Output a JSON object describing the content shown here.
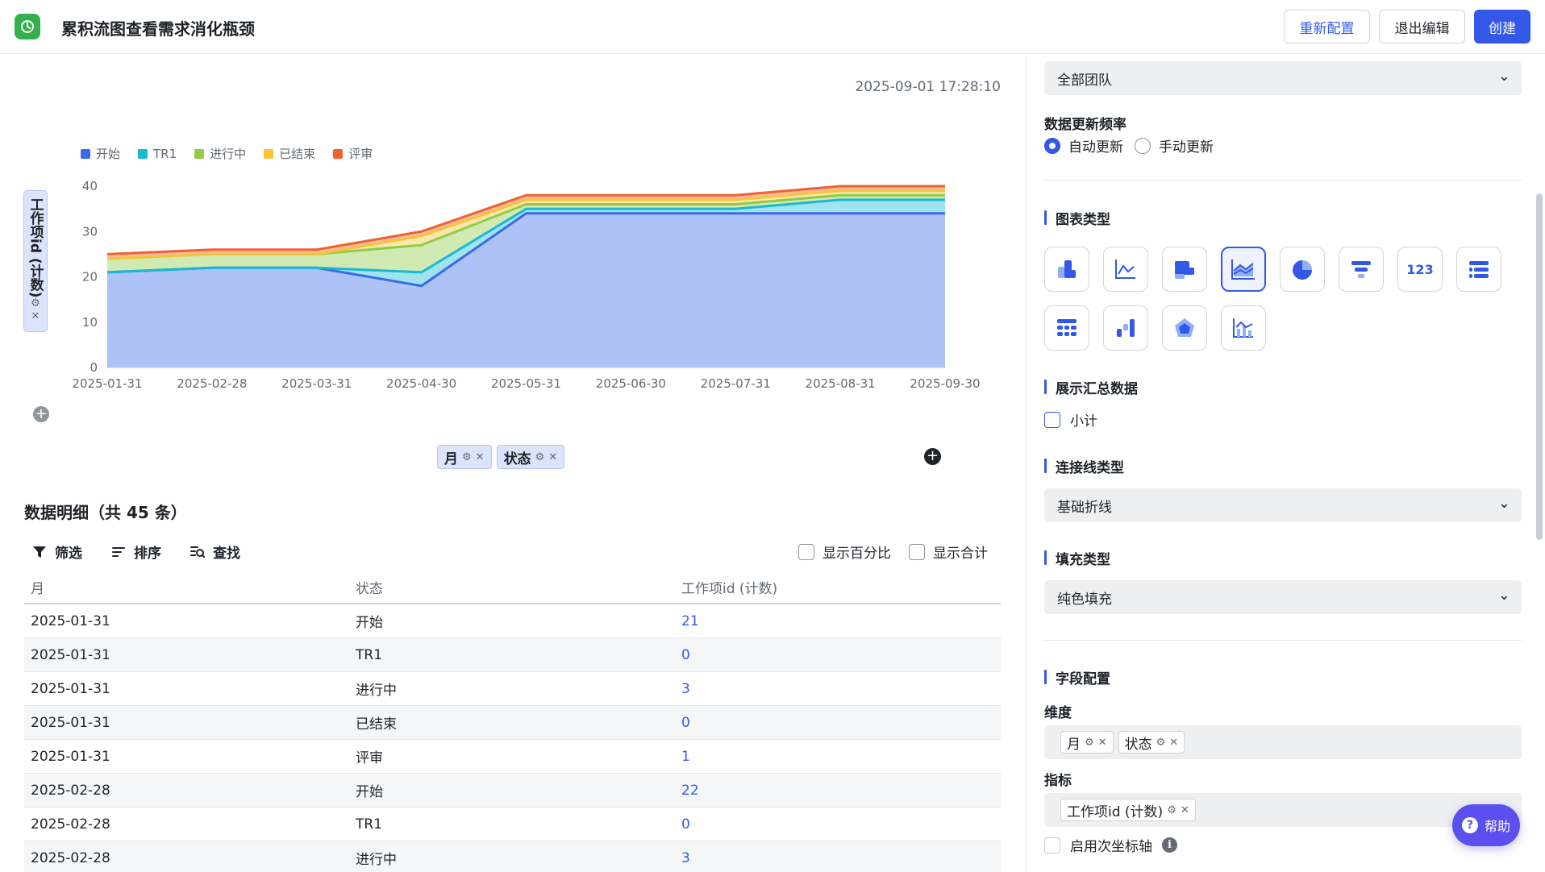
{
  "header": {
    "title": "累积流图查看需求消化瓶颈",
    "buttons": {
      "reconfigure": "重新配置",
      "exit_edit": "退出编辑",
      "create": "创建"
    }
  },
  "chart_meta": {
    "timestamp": "2025-09-01 17:28:10",
    "y_axis_field": "工作项id (计数)",
    "x_axis_fields": [
      "月",
      "状态"
    ]
  },
  "chart_data": {
    "type": "area",
    "stacked": true,
    "x": [
      "2025-01-31",
      "2025-02-28",
      "2025-03-31",
      "2025-04-30",
      "2025-05-31",
      "2025-06-30",
      "2025-07-31",
      "2025-08-31",
      "2025-09-30"
    ],
    "series": [
      {
        "name": "开始",
        "color": "#3a6ae8",
        "values": [
          21,
          22,
          22,
          18,
          34,
          34,
          34,
          34,
          34
        ]
      },
      {
        "name": "TR1",
        "color": "#19b8d3",
        "values": [
          0,
          0,
          0,
          3,
          1,
          1,
          1,
          3,
          3
        ]
      },
      {
        "name": "进行中",
        "color": "#8fcb45",
        "values": [
          3,
          3,
          3,
          6,
          1,
          1,
          1,
          1,
          1
        ]
      },
      {
        "name": "已结束",
        "color": "#f5c437",
        "values": [
          0,
          0,
          0,
          2,
          1,
          1,
          1,
          1,
          1
        ]
      },
      {
        "name": "评审",
        "color": "#f0612e",
        "values": [
          1,
          1,
          1,
          1,
          1,
          1,
          1,
          1,
          1
        ]
      }
    ],
    "ylim": [
      0,
      40
    ],
    "yticks": [
      0,
      10,
      20,
      30,
      40
    ],
    "legend_position": "top-left",
    "grid": false
  },
  "detail": {
    "title": "数据明细（共 45 条）",
    "tools": {
      "filter": "筛选",
      "sort": "排序",
      "find": "查找"
    },
    "toggles": {
      "percent": "显示百分比",
      "total": "显示合计"
    },
    "columns": [
      "月",
      "状态",
      "工作项id (计数)"
    ],
    "rows": [
      [
        "2025-01-31",
        "开始",
        "21"
      ],
      [
        "2025-01-31",
        "TR1",
        "0"
      ],
      [
        "2025-01-31",
        "进行中",
        "3"
      ],
      [
        "2025-01-31",
        "已结束",
        "0"
      ],
      [
        "2025-01-31",
        "评审",
        "1"
      ],
      [
        "2025-02-28",
        "开始",
        "22"
      ],
      [
        "2025-02-28",
        "TR1",
        "0"
      ],
      [
        "2025-02-28",
        "进行中",
        "3"
      ]
    ]
  },
  "panel": {
    "team_select": "全部团队",
    "update_freq_label": "数据更新频率",
    "update_options": {
      "auto": "自动更新",
      "manual": "手动更新"
    },
    "chart_type_label": "图表类型",
    "chart_types": [
      "bar-chart",
      "line-chart",
      "horizontal-bar-chart",
      "area-chart",
      "pie-chart",
      "funnel-chart",
      "number-card",
      "list-chart",
      "table-chart",
      "waterfall-chart",
      "radar-chart",
      "combo-chart"
    ],
    "active_chart_type": "area-chart",
    "summary_label": "展示汇总数据",
    "subtotal": "小计",
    "line_type_label": "连接线类型",
    "line_type_value": "基础折线",
    "fill_type_label": "填充类型",
    "fill_type_value": "纯色填充",
    "field_config_label": "字段配置",
    "dimension_label": "维度",
    "dimensions": [
      "月",
      "状态"
    ],
    "metric_label": "指标",
    "metrics": [
      "工作项id (计数)"
    ],
    "secondary_axis": "启用次坐标轴",
    "number_icon_text": "123"
  },
  "help": {
    "label": "帮助"
  }
}
